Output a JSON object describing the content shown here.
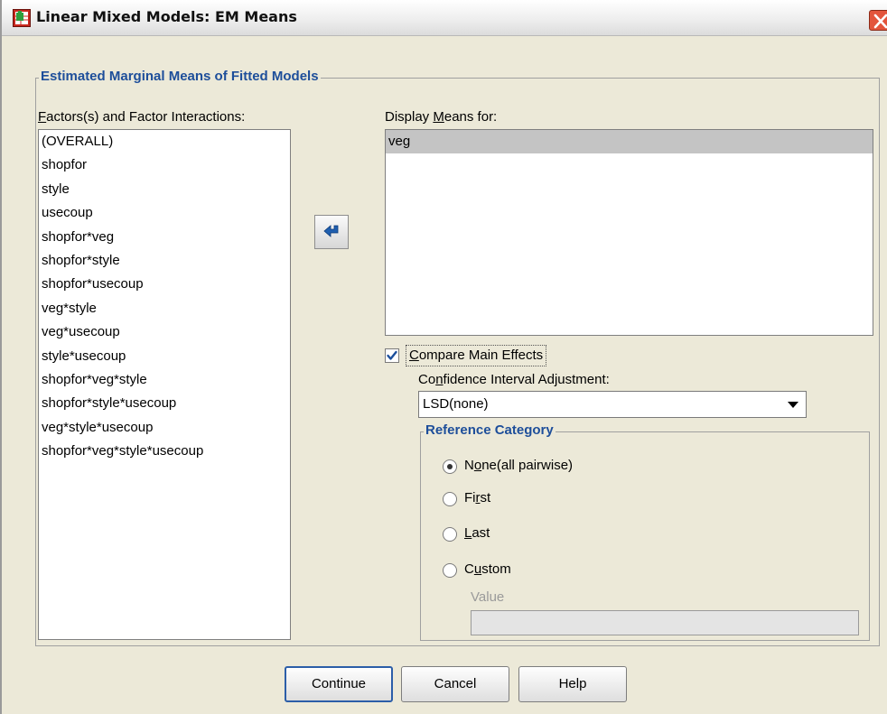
{
  "window": {
    "title": "Linear Mixed Models: EM Means"
  },
  "group": {
    "title": "Estimated Marginal Means of Fitted Models"
  },
  "factors": {
    "label_first": "F",
    "label_rest": "actors(s) and Factor Interactions:",
    "items": [
      "(OVERALL)",
      "shopfor",
      "style",
      "usecoup",
      "shopfor*veg",
      "shopfor*style",
      "shopfor*usecoup",
      "veg*style",
      "veg*usecoup",
      "style*usecoup",
      "shopfor*veg*style",
      "shopfor*style*usecoup",
      "veg*style*usecoup",
      "shopfor*veg*style*usecoup"
    ]
  },
  "display": {
    "label_pre": "Display ",
    "label_key": "M",
    "label_post": "eans for:",
    "items": [
      "veg"
    ]
  },
  "compare": {
    "checked": true,
    "label_key": "C",
    "label_rest": "ompare Main Effects"
  },
  "ci": {
    "label_pre": "Co",
    "label_key": "n",
    "label_post": "fidence Interval Adjustment:",
    "value": "LSD(none)"
  },
  "reference": {
    "title": "Reference Category",
    "options": [
      {
        "pre": "N",
        "key": "o",
        "post": "ne(all pairwise)",
        "selected": true
      },
      {
        "pre": "Fi",
        "key": "r",
        "post": "st",
        "selected": false
      },
      {
        "pre": "",
        "key": "L",
        "post": "ast",
        "selected": false
      },
      {
        "pre": "C",
        "key": "u",
        "post": "stom",
        "selected": false
      }
    ],
    "value_label": "Value",
    "value": ""
  },
  "buttons": {
    "continue": "Continue",
    "cancel": "Cancel",
    "help": "Help"
  },
  "colors": {
    "accent": "#1d4e9a",
    "selection": "#c4c4c4",
    "default_border": "#2c5ea8"
  },
  "icons": {
    "title": "spss-dialog-icon",
    "close": "close-icon",
    "move": "move-left-arrow-icon",
    "dropdown": "chevron-down-icon"
  }
}
